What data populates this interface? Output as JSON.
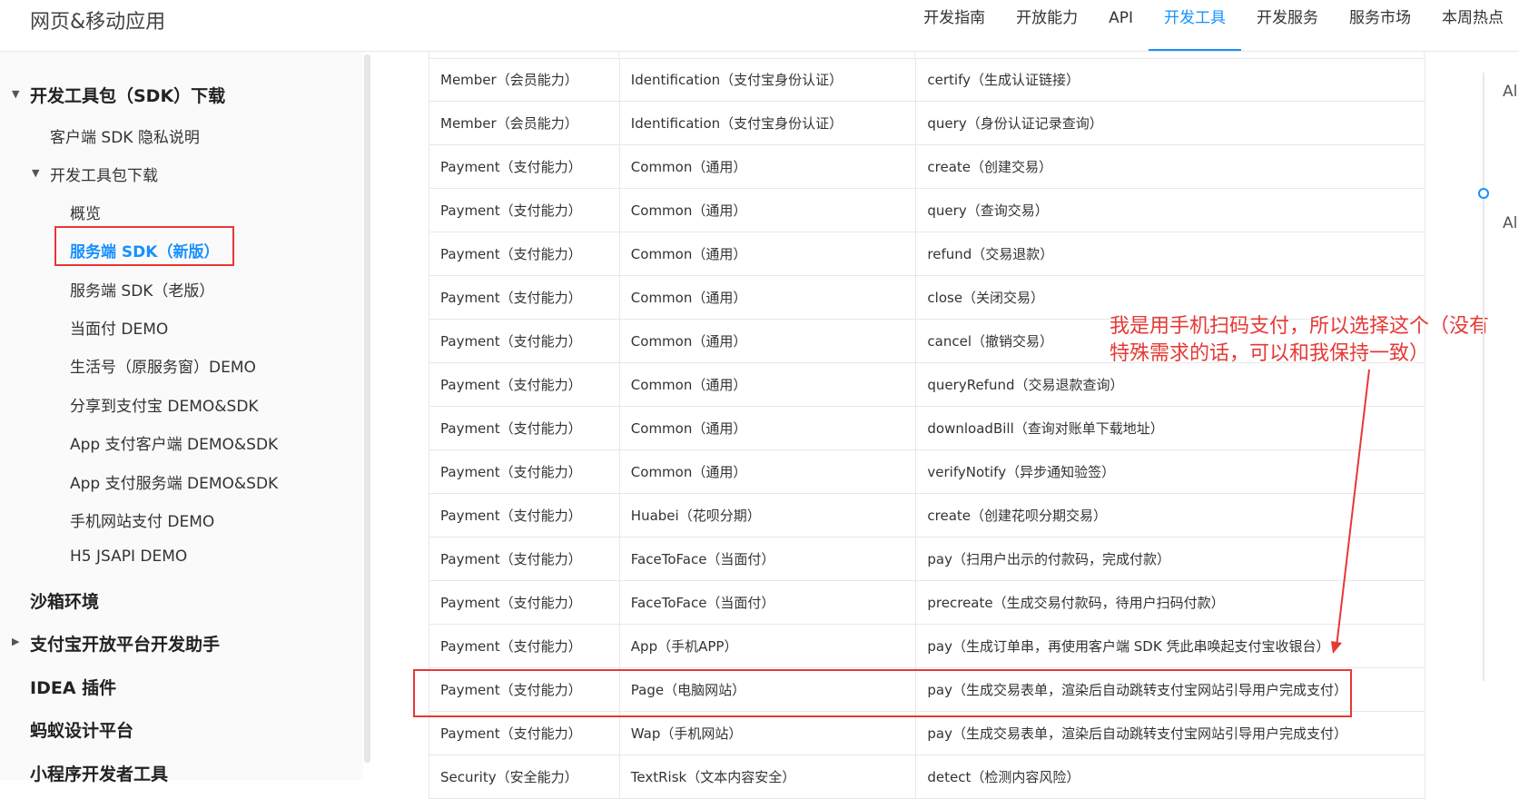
{
  "header": {
    "brand": "网页&移动应用",
    "nav": [
      {
        "label": "开发指南"
      },
      {
        "label": "开放能力"
      },
      {
        "label": "API"
      },
      {
        "label": "开发工具",
        "active": true
      },
      {
        "label": "开发服务"
      },
      {
        "label": "服务市场"
      },
      {
        "label": "本周热点"
      }
    ]
  },
  "sidebar": {
    "items": [
      {
        "label": "开发工具包（SDK）下载"
      },
      {
        "label": "客户端 SDK 隐私说明"
      },
      {
        "label": "开发工具包下载"
      },
      {
        "label": "概览"
      },
      {
        "label": "服务端 SDK（新版）",
        "active": true
      },
      {
        "label": "服务端 SDK（老版）"
      },
      {
        "label": "当面付 DEMO"
      },
      {
        "label": "生活号（原服务窗）DEMO"
      },
      {
        "label": "分享到支付宝 DEMO&SDK"
      },
      {
        "label": "App 支付客户端 DEMO&SDK"
      },
      {
        "label": "App 支付服务端 DEMO&SDK"
      },
      {
        "label": "手机网站支付 DEMO"
      },
      {
        "label": "H5 JSAPI DEMO"
      },
      {
        "label": "沙箱环境"
      },
      {
        "label": "支付宝开放平台开发助手"
      },
      {
        "label": "IDEA 插件"
      },
      {
        "label": "蚂蚁设计平台"
      },
      {
        "label": "小程序开发者工具"
      }
    ]
  },
  "table": {
    "rows": [
      [
        "Member（会员能力）",
        "Identification（支付宝身份认证）",
        "certify（生成认证链接）"
      ],
      [
        "Member（会员能力）",
        "Identification（支付宝身份认证）",
        "query（身份认证记录查询）"
      ],
      [
        "Payment（支付能力）",
        "Common（通用）",
        "create（创建交易）"
      ],
      [
        "Payment（支付能力）",
        "Common（通用）",
        "query（查询交易）"
      ],
      [
        "Payment（支付能力）",
        "Common（通用）",
        "refund（交易退款）"
      ],
      [
        "Payment（支付能力）",
        "Common（通用）",
        "close（关闭交易）"
      ],
      [
        "Payment（支付能力）",
        "Common（通用）",
        "cancel（撤销交易）"
      ],
      [
        "Payment（支付能力）",
        "Common（通用）",
        "queryRefund（交易退款查询）"
      ],
      [
        "Payment（支付能力）",
        "Common（通用）",
        "downloadBill（查询对账单下载地址）"
      ],
      [
        "Payment（支付能力）",
        "Common（通用）",
        "verifyNotify（异步通知验签）"
      ],
      [
        "Payment（支付能力）",
        "Huabei（花呗分期）",
        "create（创建花呗分期交易）"
      ],
      [
        "Payment（支付能力）",
        "FaceToFace（当面付）",
        "pay（扫用户出示的付款码，完成付款）"
      ],
      [
        "Payment（支付能力）",
        "FaceToFace（当面付）",
        "precreate（生成交易付款码，待用户扫码付款）"
      ],
      [
        "Payment（支付能力）",
        "App（手机APP）",
        "pay（生成订单串，再使用客户端 SDK 凭此串唤起支付宝收银台）"
      ],
      [
        "Payment（支付能力）",
        "Page（电脑网站）",
        "pay（生成交易表单，渲染后自动跳转支付宝网站引导用户完成支付）"
      ],
      [
        "Payment（支付能力）",
        "Wap（手机网站）",
        "pay（生成交易表单，渲染后自动跳转支付宝网站引导用户完成支付）"
      ],
      [
        "Security（安全能力）",
        "TextRisk（文本内容安全）",
        "detect（检测内容风险）"
      ]
    ]
  },
  "annotation": {
    "text_line1": "我是用手机扫码支付，所以选择这个（没有",
    "text_line2": "特殊需求的话，可以和我保持一致）"
  },
  "right_rail": {
    "item1": "Ali",
    "item2": "Ali"
  },
  "colors": {
    "accent": "#1890ff",
    "annotation_red": "#e53935"
  }
}
